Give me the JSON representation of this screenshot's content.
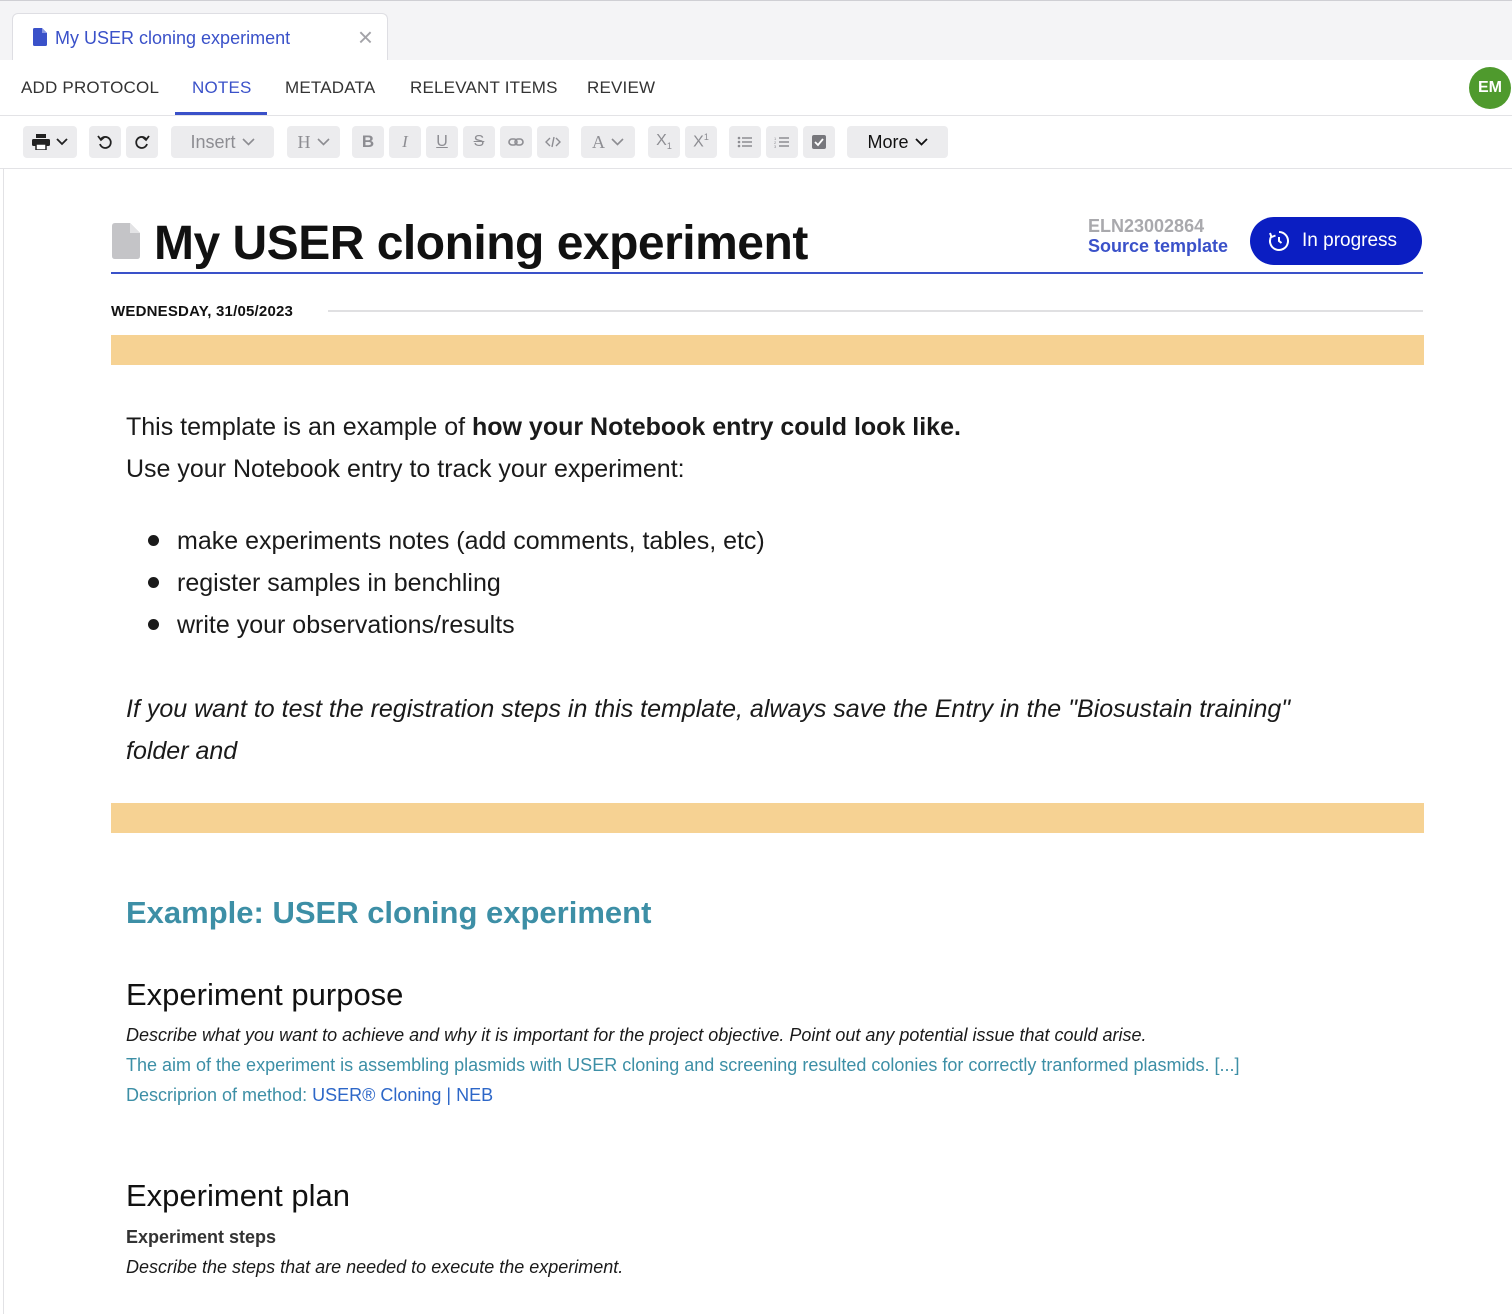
{
  "tab": {
    "title": "My USER cloning experiment",
    "close_label": "×"
  },
  "nav": {
    "tabs": [
      {
        "label": "ADD PROTOCOL"
      },
      {
        "label": "NOTES"
      },
      {
        "label": "METADATA"
      },
      {
        "label": "RELEVANT ITEMS"
      },
      {
        "label": "REVIEW"
      }
    ],
    "active_tab": "NOTES",
    "avatar_initials": "EM"
  },
  "toolbar": {
    "insert_label": "Insert",
    "heading_label": "H",
    "font_color_label": "A",
    "more_label": "More",
    "icons": [
      "print-icon",
      "undo-icon",
      "redo-icon",
      "bold-icon",
      "italic-icon",
      "underline-icon",
      "strikethrough-icon",
      "link-icon",
      "code-icon",
      "subscript-icon",
      "superscript-icon",
      "bullet-list-icon",
      "numbered-list-icon",
      "checkbox-icon"
    ]
  },
  "entry": {
    "title": "My USER cloning experiment",
    "eln_id": "ELN23002864",
    "source_template_label": "Source template",
    "status_label": "In progress",
    "date": "WEDNESDAY, 31/05/2023"
  },
  "body": {
    "intro_prefix": "This template is an example of ",
    "intro_bold": "how your Notebook entry could look like.",
    "intro_line2": "Use your Notebook entry to track your experiment:",
    "bullets": [
      "make experiments notes (add comments, tables, etc)",
      "register samples in benchling",
      "write your observations/results"
    ],
    "italic_line1": "If you want to test the registration steps in this template, always save the Entry in the \"Biosustain training\"",
    "italic_line2": "folder and",
    "section_heading": "Example: USER cloning experiment",
    "purpose_heading": "Experiment purpose",
    "purpose_desc": "Describe what you want to achieve and why it is important for the project objective. Point out any potential issue that could arise.",
    "purpose_aim": "The aim of the experiment is assembling plasmids with USER cloning and screening resulted colonies for correctly tranformed plasmids. [...]",
    "method_prefix": "Descriprion of method: ",
    "method_link": "USER® Cloning | NEB",
    "plan_heading": "Experiment plan",
    "steps_heading": "Experiment steps",
    "steps_desc": "Describe the steps that are needed to execute the experiment."
  },
  "colors": {
    "accent": "#3a51c9",
    "status_bg": "#0b1ec2",
    "band": "#f6d293",
    "teal": "#3d8fa6",
    "avatar": "#4f9a2d"
  }
}
